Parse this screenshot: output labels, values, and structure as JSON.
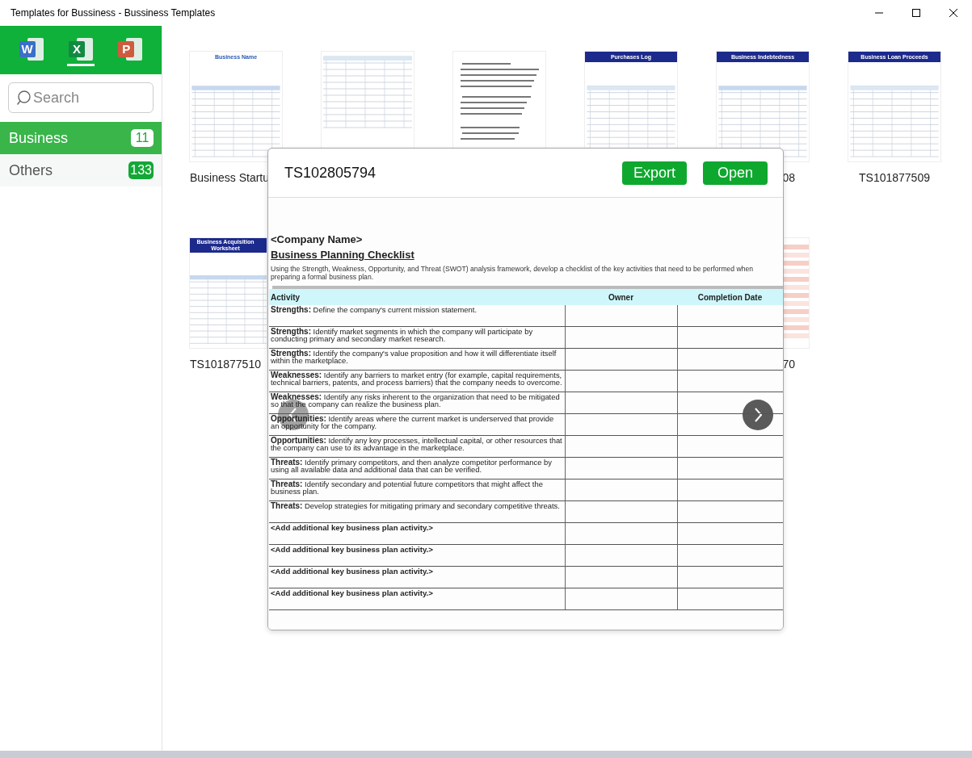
{
  "window": {
    "title": "Templates for Bussiness - Bussiness Templates"
  },
  "app_tabs": [
    {
      "letter": "W",
      "selected": false
    },
    {
      "letter": "X",
      "selected": true
    },
    {
      "letter": "P",
      "selected": false
    }
  ],
  "search": {
    "placeholder": "Search"
  },
  "categories": [
    {
      "label": "Business",
      "count": "11",
      "selected": true
    },
    {
      "label": "Others",
      "count": "133",
      "selected": false
    }
  ],
  "grid": {
    "rows": [
      {
        "cells": [
          {
            "kind": "sheet",
            "title": "Business Name",
            "caption": "Business Startu"
          },
          {
            "kind": "sheet"
          },
          {
            "kind": "text-doc"
          },
          {
            "kind": "banner-sheet",
            "title": "Purchases Log"
          },
          {
            "kind": "banner-sheet",
            "title": "Business Indebtedness",
            "caption": "08"
          },
          {
            "kind": "banner-sheet",
            "title": "Business Loan Proceeds",
            "caption": "TS101877509"
          }
        ]
      },
      {
        "cells": [
          {
            "kind": "banner-sheet",
            "title": "Business Acquisition Worksheet",
            "caption": "TS101877510"
          },
          {
            "kind": "covered"
          },
          {
            "kind": "covered"
          },
          {
            "kind": "covered"
          },
          {
            "kind": "pink-sheet",
            "caption": "70"
          }
        ]
      }
    ]
  },
  "preview": {
    "code": "TS102805794",
    "buttons": [
      "Export",
      "Open"
    ],
    "document": {
      "heading": "<Company Name>",
      "title": "Business Planning Checklist",
      "intro": "Using the Strength, Weakness, Opportunity, and Threat (SWOT) analysis framework, develop a checklist of the key activities that need to be performed when preparing a formal business plan.",
      "columns": [
        "Activity",
        "Owner",
        "Completion Date"
      ],
      "rows": [
        {
          "kind": "item",
          "text": "**Strengths:** Define the company's current mission statement."
        },
        {
          "kind": "item",
          "text": "**Strengths:** Identify market segments in which the company will participate by conducting primary and secondary market research."
        },
        {
          "kind": "item",
          "text": "**Strengths:** Identify the company's value proposition and how it will differentiate itself within the marketplace."
        },
        {
          "kind": "item",
          "text": "**Weaknesses:** Identify any barriers to market entry (for example, capital requirements, technical barriers, patents, and process barriers) that the company needs to overcome."
        },
        {
          "kind": "item",
          "text": "**Weaknesses:** Identify any risks inherent to the organization that need to be mitigated so that the company can realize the business plan."
        },
        {
          "kind": "item",
          "text": "**Opportunities:** Identify areas where the current market is underserved that provide an opportunity for the company."
        },
        {
          "kind": "item",
          "text": "**Opportunities:** Identify any key processes, intellectual capital, or other resources that the company can use to its advantage in the marketplace."
        },
        {
          "kind": "item",
          "text": "**Threats:** Identify primary competitors, and then analyze competitor performance by using all available data and additional data that can be verified."
        },
        {
          "kind": "item",
          "text": "**Threats:** Identify secondary and potential future competitors that might affect the business plan."
        },
        {
          "kind": "item",
          "text": "**Threats:** Develop strategies for mitigating primary and secondary competitive threats."
        },
        {
          "kind": "placeholder",
          "text": "<Add additional key business plan activity.>"
        },
        {
          "kind": "placeholder",
          "text": "<Add additional key business plan activity.>"
        },
        {
          "kind": "placeholder",
          "text": "<Add additional key business plan activity.>"
        },
        {
          "kind": "placeholder",
          "text": "<Add additional key business plan activity.>"
        }
      ]
    }
  }
}
